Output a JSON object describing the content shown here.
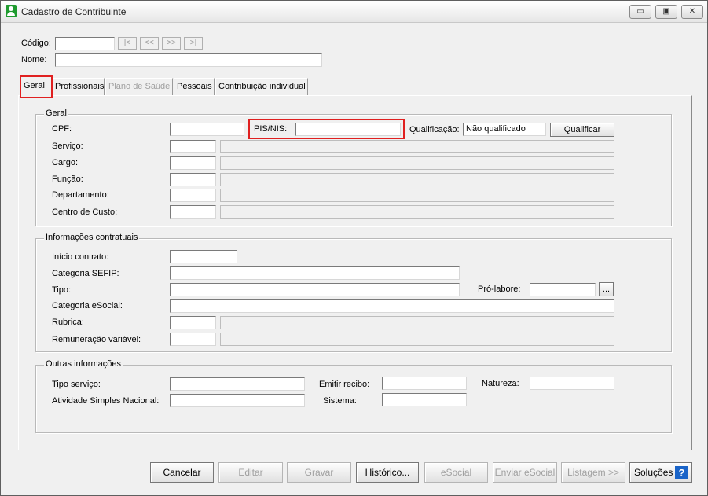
{
  "window": {
    "title": "Cadastro de Contribuinte",
    "min_glyph": "▭",
    "max_glyph": "▣",
    "close_glyph": "✕"
  },
  "header": {
    "codigo_label": "Código:",
    "codigo_value": "",
    "nome_label": "Nome:",
    "nome_value": "",
    "nav": {
      "first": "|<",
      "prev": "<<",
      "next": ">>",
      "last": ">|"
    }
  },
  "tabs": [
    "Geral",
    "Profissionais",
    "Plano de Saúde",
    "Pessoais",
    "Contribuição individual"
  ],
  "geral": {
    "title": "Geral",
    "cpf_label": "CPF:",
    "pis_label": "PIS/NIS:",
    "qualificacao_label": "Qualificação:",
    "qualificacao_value": "Não qualificado",
    "qualificar_button": "Qualificar",
    "servico_label": "Serviço:",
    "cargo_label": "Cargo:",
    "funcao_label": "Função:",
    "departamento_label": "Departamento:",
    "centro_custo_label": "Centro de Custo:"
  },
  "contratuais": {
    "title": "Informações contratuais",
    "inicio_label": "Início contrato:",
    "categoria_sefip_label": "Categoria SEFIP:",
    "tipo_label": "Tipo:",
    "pro_labore_label": "Pró-labore:",
    "ellipsis_button": "...",
    "categoria_esocial_label": "Categoria eSocial:",
    "rubrica_label": "Rubrica:",
    "remuneracao_label": "Remuneração variável:"
  },
  "outras": {
    "title": "Outras informações",
    "tipo_servico_label": "Tipo serviço:",
    "emitir_recibo_label": "Emitir recibo:",
    "natureza_label": "Natureza:",
    "atividade_label": "Atividade Simples Nacional:",
    "sistema_label": "Sistema:"
  },
  "footer": {
    "cancelar": "Cancelar",
    "editar": "Editar",
    "gravar": "Gravar",
    "historico": "Histórico...",
    "esocial": "eSocial",
    "enviar_esocial": "Enviar eSocial",
    "listagem": "Listagem >>",
    "solucoes": "Soluções",
    "help_glyph": "?"
  },
  "colors": {
    "highlight": "#e02020",
    "help_icon": "#1a64c8",
    "app_icon": "#1f9b2f"
  }
}
